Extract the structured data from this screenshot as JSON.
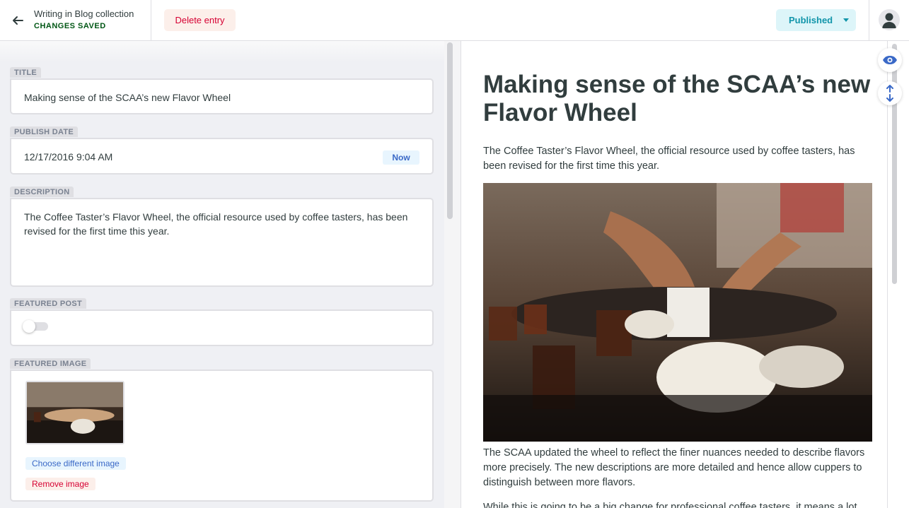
{
  "header": {
    "collection_label": "Writing in Blog collection",
    "save_status": "CHANGES SAVED",
    "delete_label": "Delete entry",
    "status_label": "Published"
  },
  "editor": {
    "title": {
      "label": "TITLE",
      "value": "Making sense of the SCAA’s new Flavor Wheel"
    },
    "publish_date": {
      "label": "PUBLISH DATE",
      "value": "12/17/2016 9:04 AM",
      "now_label": "Now"
    },
    "description": {
      "label": "DESCRIPTION",
      "value": "The Coffee Taster’s Flavor Wheel, the official resource used by coffee tasters, has been revised for the first time this year."
    },
    "featured_post": {
      "label": "FEATURED POST",
      "enabled": false
    },
    "featured_image": {
      "label": "FEATURED IMAGE",
      "choose_label": "Choose different image",
      "remove_label": "Remove image"
    }
  },
  "preview": {
    "title": "Making sense of the SCAA’s new Flavor Wheel",
    "intro": "The Coffee Taster’s Flavor Wheel, the official resource used by coffee tasters, has been revised for the first time this year.",
    "body_1": "The SCAA updated the wheel to reflect the finer nuances needed to describe flavors more precisely. The new descriptions are more detailed and hence allow cuppers to distinguish between more flavors.",
    "body_2": "While this is going to be a big change for professional coffee tasters, it means a lot"
  },
  "colors": {
    "accent_blue": "#3a69c7",
    "danger_red": "#d60032",
    "success_green": "#005614",
    "status_teal": "#1195aa"
  },
  "icons": {
    "back": "arrow-left-icon",
    "caret": "chevron-down-icon",
    "user": "user-avatar-icon",
    "preview": "eye-icon",
    "scroll_sync": "scroll-sync-icon"
  }
}
